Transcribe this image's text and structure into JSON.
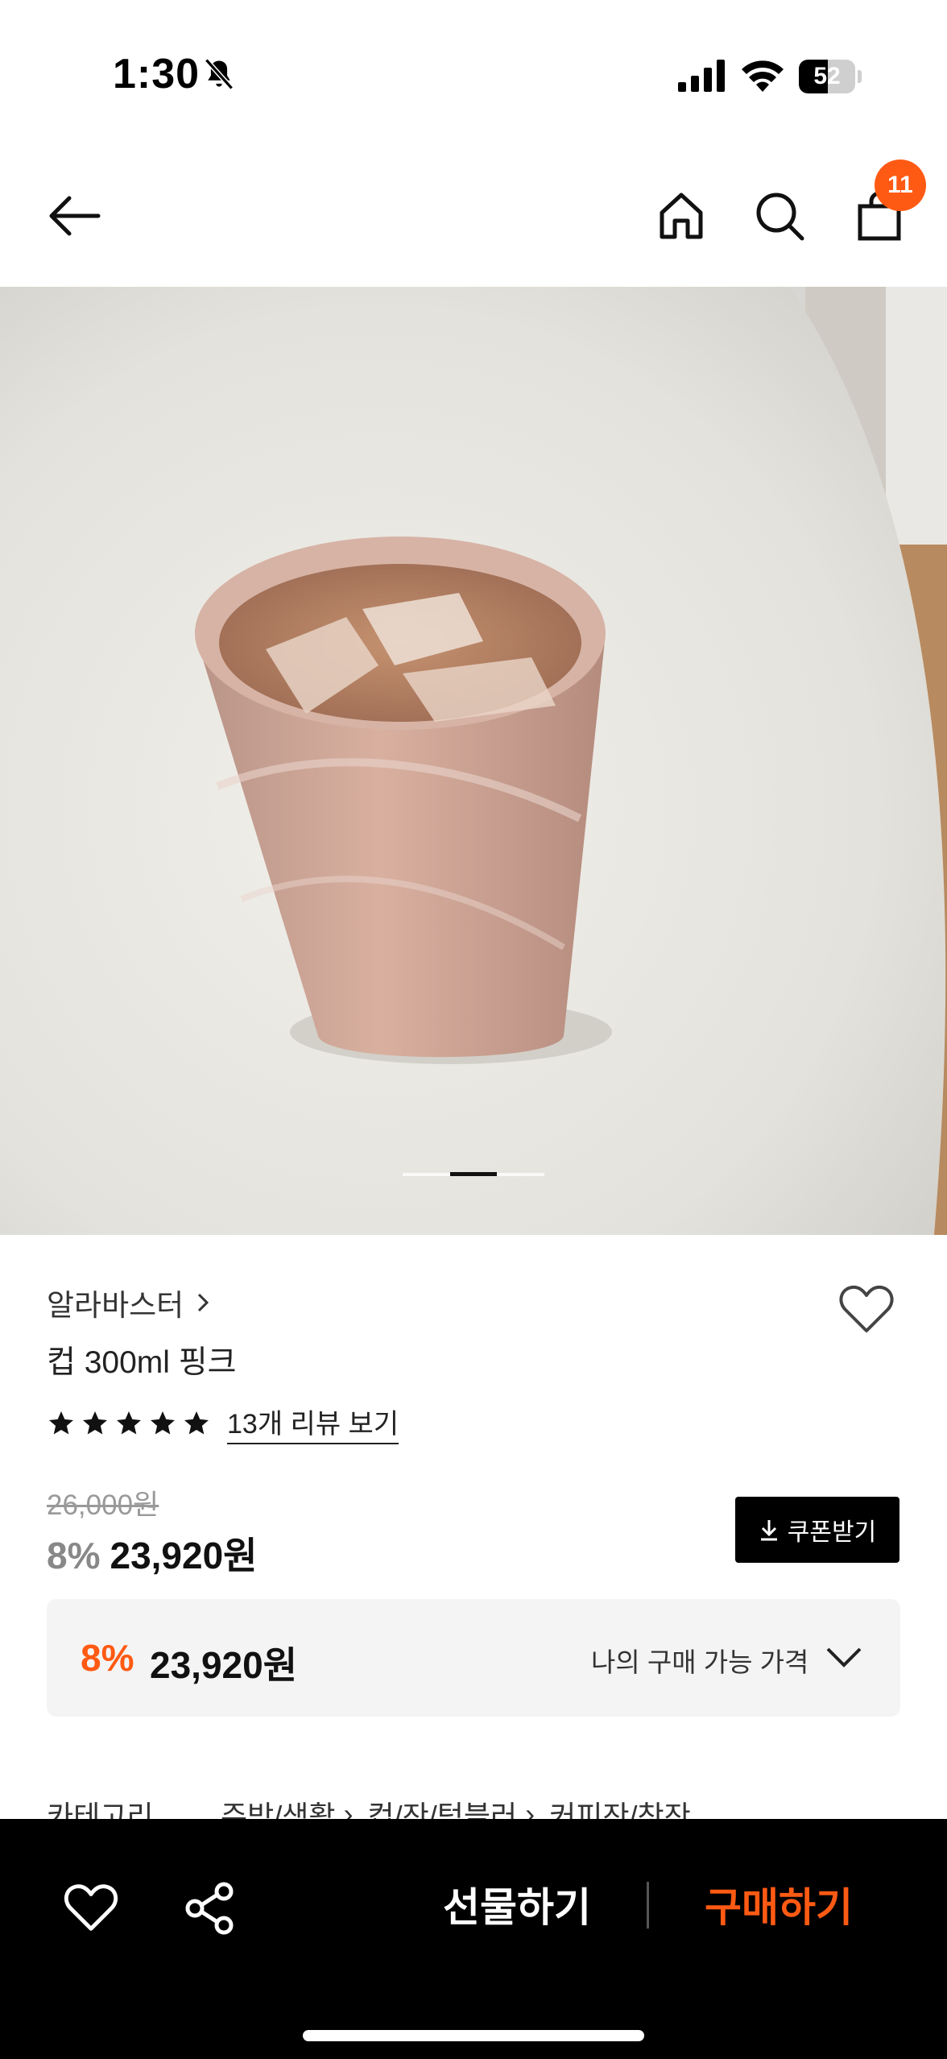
{
  "status_bar": {
    "time": "1:30",
    "battery": "52",
    "battery_level": 0.52
  },
  "nav": {
    "cart_count": "11"
  },
  "carousel": {
    "current_index": 2,
    "total": 3
  },
  "product": {
    "brand": "알라바스터",
    "name": "컵 300ml 핑크",
    "rating_stars": 5,
    "review_link": "13개 리뷰 보기",
    "original_price": "26,000원",
    "discount": "8%",
    "price": "23,920원",
    "coupon_button": "쿠폰받기"
  },
  "my_price": {
    "discount": "8%",
    "price": "23,920원",
    "label": "나의 구매 가능 가격"
  },
  "category": {
    "label": "카테고리",
    "path": [
      "주방/생활",
      "컵/잔/텀블러",
      "커피잔/찻잔"
    ]
  },
  "bottom_bar": {
    "gift_label": "선물하기",
    "buy_label": "구매하기"
  },
  "colors": {
    "accent": "#ff5a13",
    "bottom_bar": "#000000"
  }
}
